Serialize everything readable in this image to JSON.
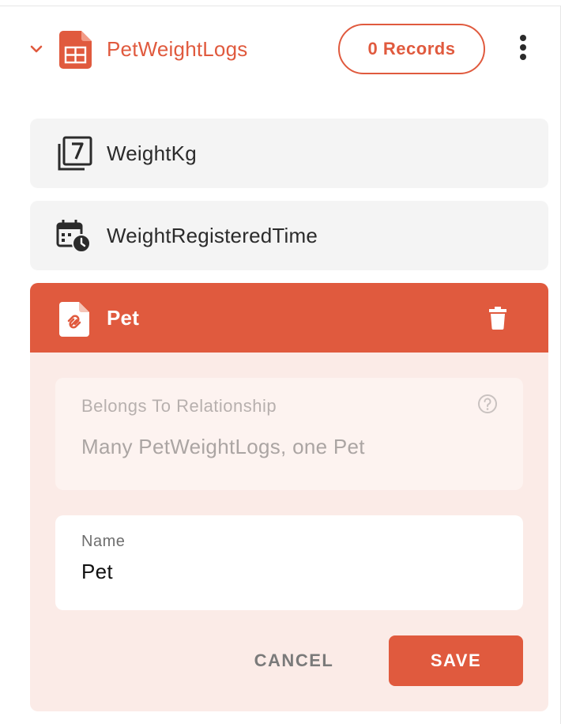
{
  "table": {
    "title": "PetWeightLogs",
    "records_label": "0 Records",
    "collapse_icon": "chevron-down-icon",
    "table_icon": "table-file-icon",
    "menu_icon": "kebab-menu-icon"
  },
  "fields": [
    {
      "label": "WeightKg",
      "icon": "number-field-icon"
    },
    {
      "label": "WeightRegisteredTime",
      "icon": "calendar-clock-icon"
    }
  ],
  "relation": {
    "label": "Pet",
    "icon": "linked-file-icon",
    "delete_icon": "trash-icon",
    "type_caption": "Belongs To Relationship",
    "type_value": "Many PetWeightLogs, one Pet",
    "help_icon": "help-circle-icon",
    "name_caption": "Name",
    "name_value": "Pet",
    "cancel_label": "CANCEL",
    "save_label": "SAVE"
  },
  "colors": {
    "accent": "#e05a3e",
    "panel_bg": "#fbebe7",
    "row_bg": "#f4f4f4"
  }
}
